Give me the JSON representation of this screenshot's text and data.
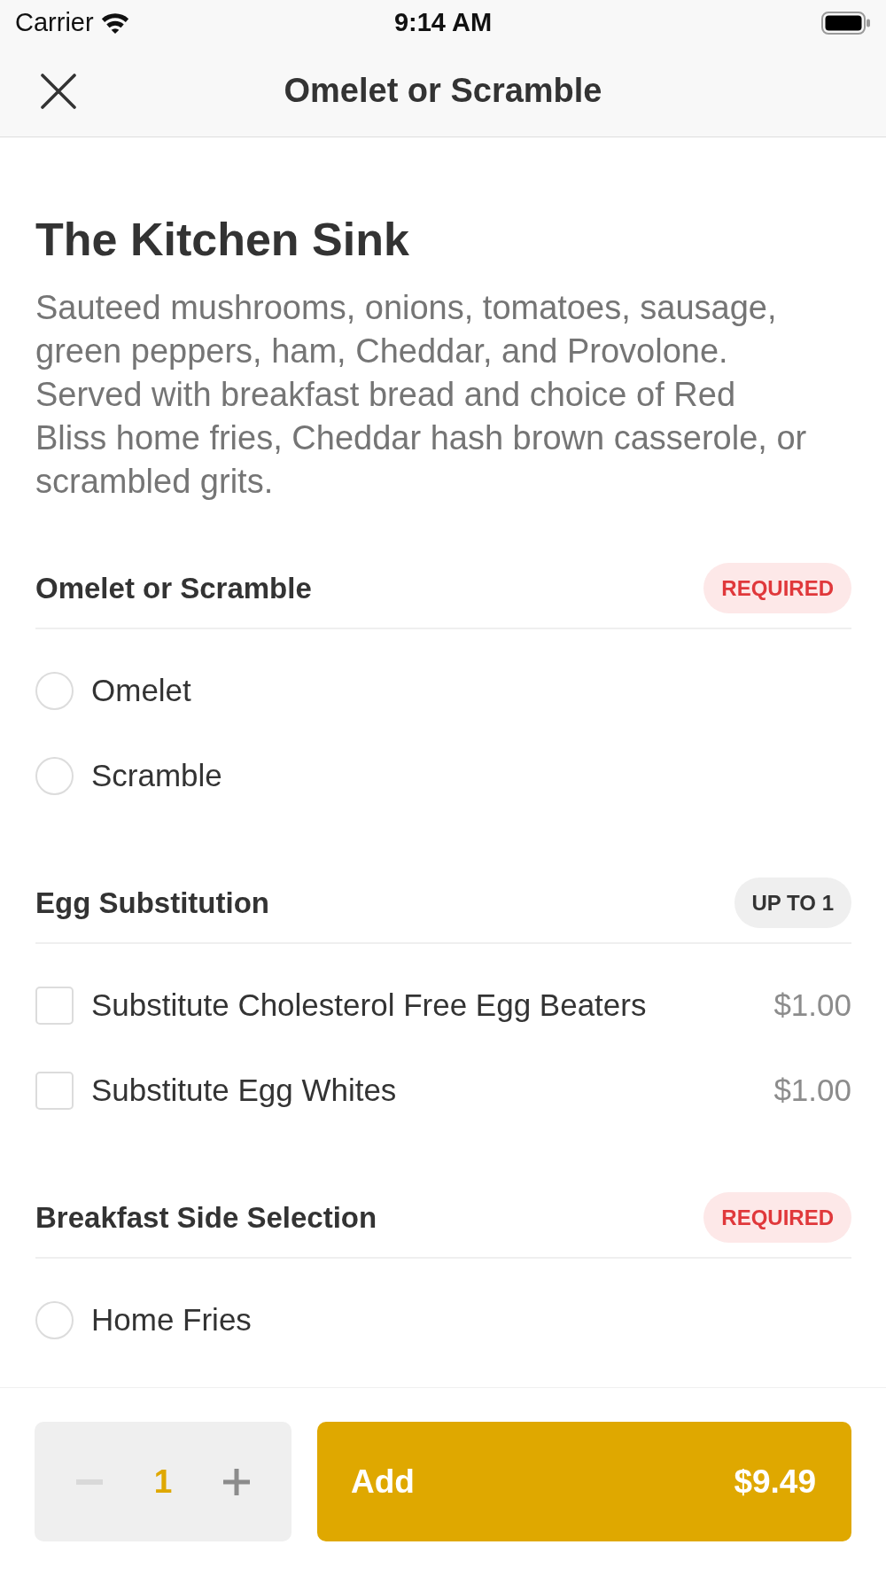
{
  "status_bar": {
    "carrier": "Carrier",
    "time": "9:14 AM"
  },
  "nav_bar": {
    "title": "Omelet or Scramble"
  },
  "item": {
    "name": "The Kitchen Sink",
    "description": "Sauteed mushrooms, onions, tomatoes, sausage, green peppers, ham, Cheddar, and Provolone. Served with breakfast bread and choice of Red Bliss home fries, Cheddar hash brown casserole, or scrambled grits."
  },
  "option_groups": [
    {
      "title": "Omelet or Scramble",
      "badge": {
        "kind": "required",
        "text": "REQUIRED"
      },
      "options": [
        {
          "kind": "radio",
          "label": "Omelet",
          "selected": false
        },
        {
          "kind": "radio",
          "label": "Scramble",
          "selected": false
        }
      ]
    },
    {
      "title": "Egg Substitution",
      "badge": {
        "kind": "limit",
        "text": "UP TO 1"
      },
      "options": [
        {
          "kind": "checkbox",
          "label": "Substitute Cholesterol Free Egg Beaters",
          "price": "$1.00",
          "checked": false
        },
        {
          "kind": "checkbox",
          "label": "Substitute Egg Whites",
          "price": "$1.00",
          "checked": false
        }
      ]
    },
    {
      "title": "Breakfast Side Selection",
      "badge": {
        "kind": "required",
        "text": "REQUIRED"
      },
      "options": [
        {
          "kind": "radio",
          "label": "Home Fries",
          "selected": false
        }
      ]
    }
  ],
  "footer": {
    "decrement": {
      "disabled": true
    },
    "quantity": "1",
    "add_button": {
      "label": "Add",
      "price": "$9.49"
    }
  }
}
